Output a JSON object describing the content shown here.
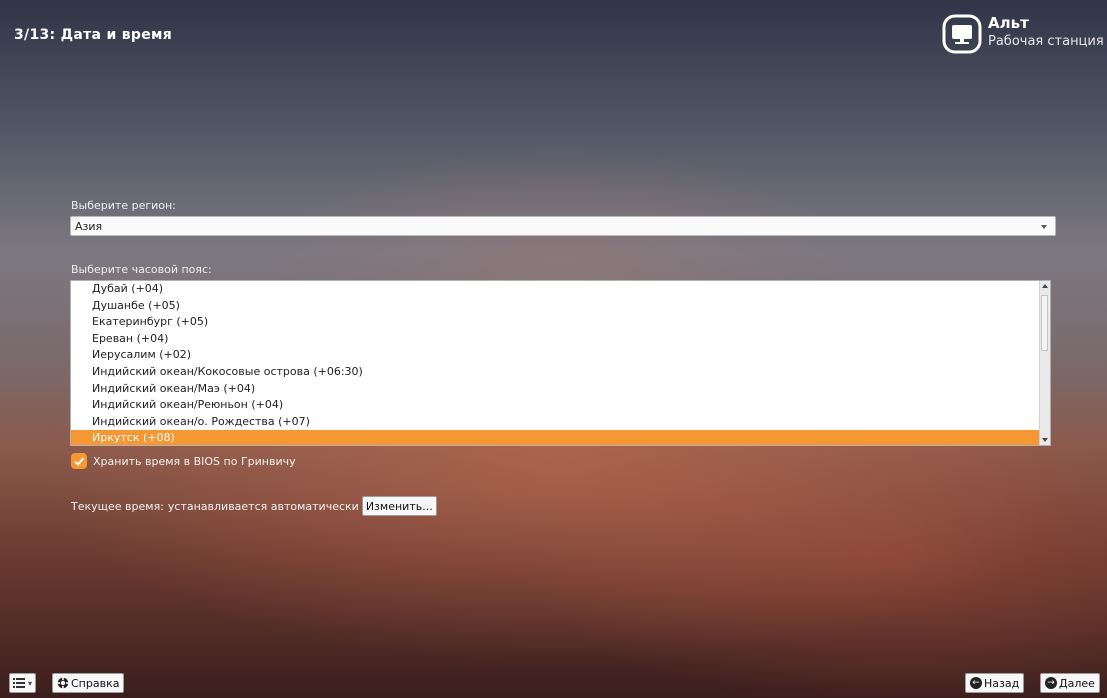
{
  "header": {
    "step_title": "3/13: Дата и время",
    "brand_name": "Альт",
    "brand_subtitle": "Рабочая станция",
    "logo_icon": "monitor-icon"
  },
  "region": {
    "label": "Выберите регион:",
    "selected": "Азия"
  },
  "timezone": {
    "label": "Выберите часовой пояс:",
    "items": [
      "Дубай (+04)",
      "Душанбе (+05)",
      "Екатеринбург (+05)",
      "Ереван (+04)",
      "Иерусалим (+02)",
      "Индийский океан/Кокосовые острова (+06:30)",
      "Индийский океан/Маэ (+04)",
      "Индийский океан/Реюньон (+04)",
      "Индийский океан/о. Рождества (+07)",
      "Иркутск (+08)"
    ],
    "selected_index": 9
  },
  "bios_utc": {
    "label": "Хранить время в BIOS по Гринвичу",
    "checked": true
  },
  "current_time": {
    "label": "Текущее время:",
    "value": "устанавливается автоматически",
    "change_button": "Изменить..."
  },
  "footer": {
    "help_label": "Справка",
    "back_label": "Назад",
    "next_label": "Далее"
  },
  "colors": {
    "accent": "#f59733",
    "text_light": "#ffffff"
  }
}
